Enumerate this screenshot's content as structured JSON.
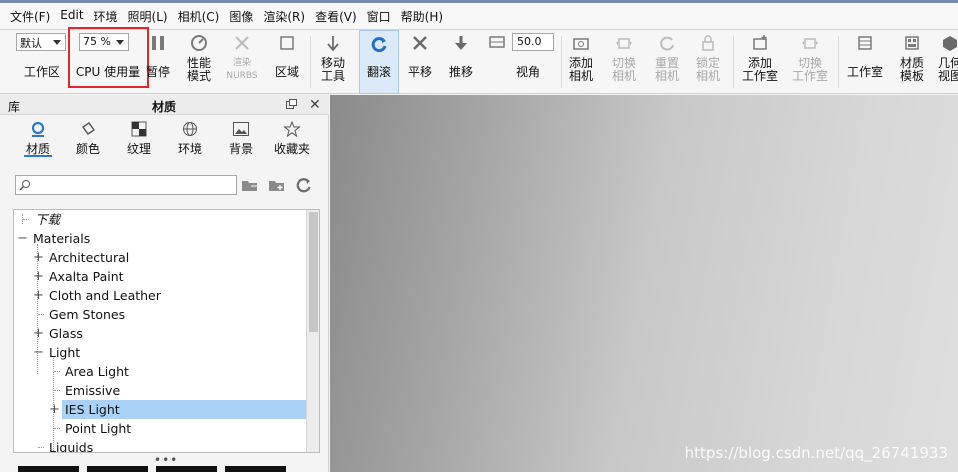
{
  "menu": [
    "文件(F)",
    "Edit",
    "环境",
    "照明(L)",
    "相机(C)",
    "图像",
    "渲染(R)",
    "查看(V)",
    "窗口",
    "帮助(H)"
  ],
  "toolbar": {
    "preset_value": "默认",
    "workspace_label": "工作区",
    "cpu_value": "75 %",
    "cpu_label": "CPU 使用量",
    "pause_label": "暂停",
    "perf_mode_label": "性能\n模式",
    "render_nurbs_label": "渲染\nNURBS",
    "region_label": "区域",
    "move_tool_label": "移动\n工具",
    "tumble_label": "翻滚",
    "pan_label": "平移",
    "dolly_label": "推移",
    "fov_value": "50.0",
    "view_angle_label": "视角",
    "add_camera_label": "添加\n相机",
    "switch_camera_label": "切换\n相机",
    "reset_camera_label": "重置\n相机",
    "lock_camera_label": "锁定\n相机",
    "add_studio_label": "添加\n工作室",
    "switch_studio_label": "切换\n工作室",
    "studio_label": "工作室",
    "material_template_label": "材质\n模板",
    "geometry_view_label": "几何\n视图"
  },
  "panel": {
    "library_label": "库",
    "title": "材质",
    "tabs": [
      "材质",
      "颜色",
      "纹理",
      "环境",
      "背景",
      "收藏夹"
    ],
    "search_placeholder": ""
  },
  "tree": [
    {
      "label": "下载",
      "italic": true
    },
    {
      "label": "Materials"
    },
    {
      "label": "Architectural"
    },
    {
      "label": "Axalta Paint"
    },
    {
      "label": "Cloth and Leather"
    },
    {
      "label": "Gem Stones"
    },
    {
      "label": "Glass"
    },
    {
      "label": "Light"
    },
    {
      "label": "Area Light"
    },
    {
      "label": "Emissive"
    },
    {
      "label": "IES Light",
      "selected": true
    },
    {
      "label": "Point Light"
    },
    {
      "label": "Liquids"
    }
  ],
  "panel_footer": "•••",
  "watermark": "https://blog.csdn.net/qq_26741933",
  "colors": {
    "accent": "#2a78d0",
    "selected_row": "#aad2f7",
    "highlight_box": "#e0282e"
  }
}
